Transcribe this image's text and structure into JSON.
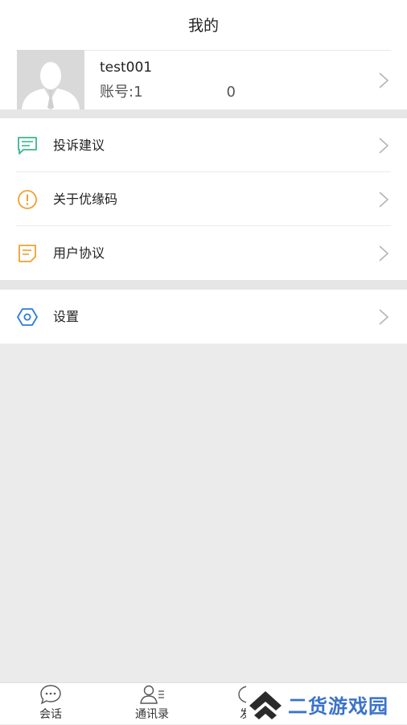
{
  "header": {
    "title": "我的"
  },
  "profile": {
    "name": "test001",
    "account_prefix": "账号:1",
    "account_suffix": "0"
  },
  "menu_group1": [
    {
      "label": "投诉建议",
      "icon": "chat-message-icon",
      "icon_color": "#3bb88a"
    },
    {
      "label": "关于优缘码",
      "icon": "info-circle-icon",
      "icon_color": "#f0a030"
    },
    {
      "label": "用户协议",
      "icon": "document-icon",
      "icon_color": "#f0a030"
    }
  ],
  "menu_group2": [
    {
      "label": "设置",
      "icon": "hexagon-settings-icon",
      "icon_color": "#2c7be0"
    }
  ],
  "tabbar": {
    "tabs": [
      {
        "label": "会话",
        "icon": "chat-bubble-icon"
      },
      {
        "label": "通讯录",
        "icon": "contacts-icon"
      },
      {
        "label": "发",
        "icon": "discover-icon"
      }
    ]
  },
  "watermark": {
    "text": "二货游戏园"
  }
}
